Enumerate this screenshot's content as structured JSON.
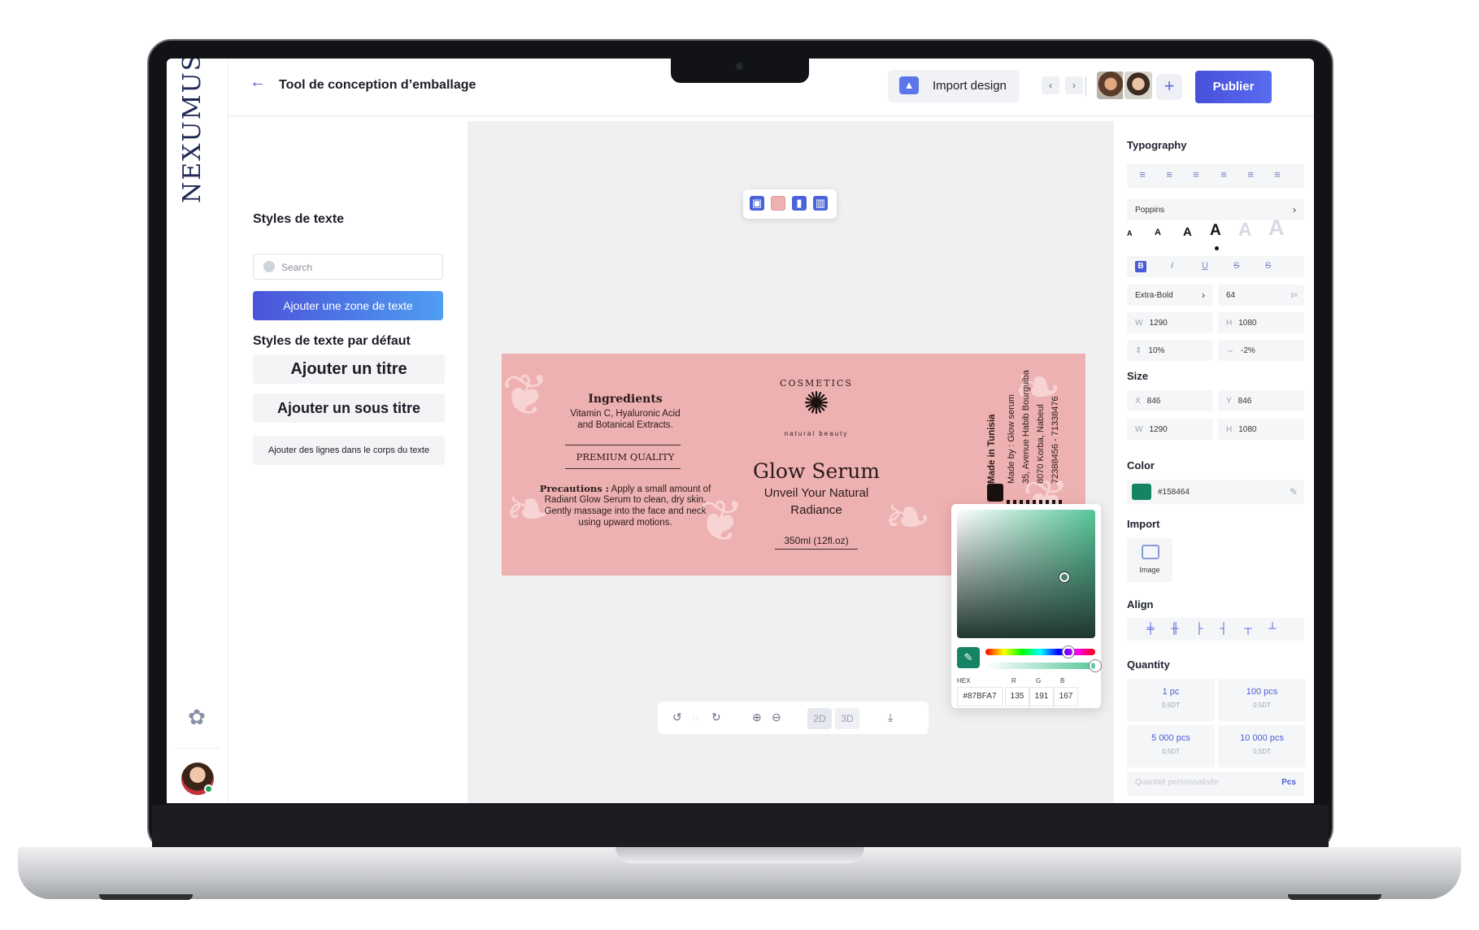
{
  "app": {
    "brand": "NEXUMUS",
    "title": "Tool de conception d’emballage",
    "import_label": "Import design",
    "publish_label": "Publier"
  },
  "left_panel": {
    "heading": "Styles de texte",
    "search_placeholder": "Search",
    "add_zone": "Ajouter une zone de texte",
    "defaults_heading": "Styles de texte par défaut",
    "title_style": "Ajouter un titre",
    "subtitle_style": "Ajouter un sous titre",
    "body_style": "Ajouter des lignes dans le corps du texte"
  },
  "label": {
    "ingredients_title": "Ingredients",
    "ingredients_text1": "Vitamin C, Hyaluronic Acid",
    "ingredients_text2": "and Botanical Extracts.",
    "premium": "PREMIUM QUALITY",
    "precautions_title": "Precautions :",
    "precautions_text1": " Apply a small amount of",
    "precautions_text2": "Radiant Glow Serum to clean, dry skin.",
    "precautions_text3": "Gently massage into the face and neck",
    "precautions_text4": "using upward motions.",
    "cosmetics": "COSMETICS",
    "natural": "natural beauty",
    "product": "Glow Serum",
    "tagline1": "Unveil Your Natural",
    "tagline2": "Radiance",
    "volume": "350ml (12fl.oz)",
    "side1": "Made in Tunisia",
    "side2": "Made by : Glow serum",
    "side3": "35, Avenue Habib Bourguiba",
    "side4": "8070 Korba, Nabeul",
    "side5": "72388456 - 71338476"
  },
  "canvas_controls": {
    "mode_2d": "2D",
    "mode_3d": "3D"
  },
  "color_picker": {
    "hex_label": "HEX",
    "r_label": "R",
    "g_label": "G",
    "b_label": "B",
    "hex": "#87BFA7",
    "r": "135",
    "g": "191",
    "b": "167"
  },
  "right_panel": {
    "typography": "Typography",
    "font": "Poppins",
    "weight": "Extra-Bold",
    "size": "64",
    "unit": "px",
    "w_label": "W",
    "h_label": "H",
    "w": "1290",
    "h": "1080",
    "line_height": "10%",
    "letter_spacing": "-2%",
    "size_heading": "Size",
    "x_label": "X",
    "y_label": "Y",
    "x": "846",
    "y": "846",
    "size_w": "1290",
    "size_h": "1080",
    "color_heading": "Color",
    "color_hex": "#158464",
    "color_swatch": "#158464",
    "import_heading": "Import",
    "image_label": "Image",
    "align_heading": "Align",
    "quantity_heading": "Quantity",
    "custom_qty": "Quantité personnalisée",
    "pcs": "Pcs",
    "quantities": [
      {
        "amount": "1 pc",
        "price": "0,5DT"
      },
      {
        "amount": "100 pcs",
        "price": "0,5DT"
      },
      {
        "amount": "5 000 pcs",
        "price": "0,5DT"
      },
      {
        "amount": "10 000 pcs",
        "price": "0,5DT"
      }
    ]
  }
}
